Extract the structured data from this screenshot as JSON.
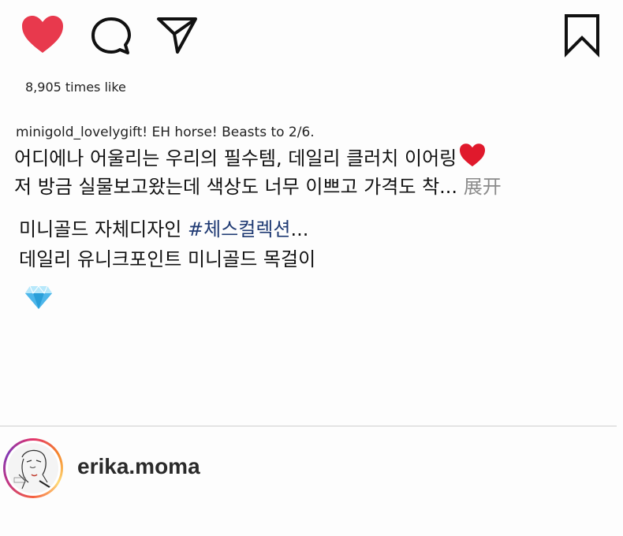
{
  "actions": {
    "like_icon": "heart-icon",
    "comment_icon": "comment-icon",
    "share_icon": "paper-plane-icon",
    "save_icon": "bookmark-icon",
    "like_color": "#e8394d"
  },
  "likes_text": "8,905 times like",
  "caption": {
    "header": "minigold_lovelygift! EH horse! Beasts to 2/6.",
    "line1": "어디에나 어울리는 우리의 필수템, 데일리 클러치 이어링",
    "line2": "저 방금 실물보고왔는데 색상도 너무 이쁘고 가격도 착...",
    "more_label": "展开",
    "line3_prefix": "미니골드 자체디자인 ",
    "line3_hashtag": "#체스컬렉션",
    "line3_suffix": "...",
    "line4": "데일리 유니크포인트 미니골드 목걸이",
    "gem_icon": "gem-icon",
    "hashtag_color": "#1f3a73"
  },
  "profile": {
    "username": "erika.moma"
  }
}
